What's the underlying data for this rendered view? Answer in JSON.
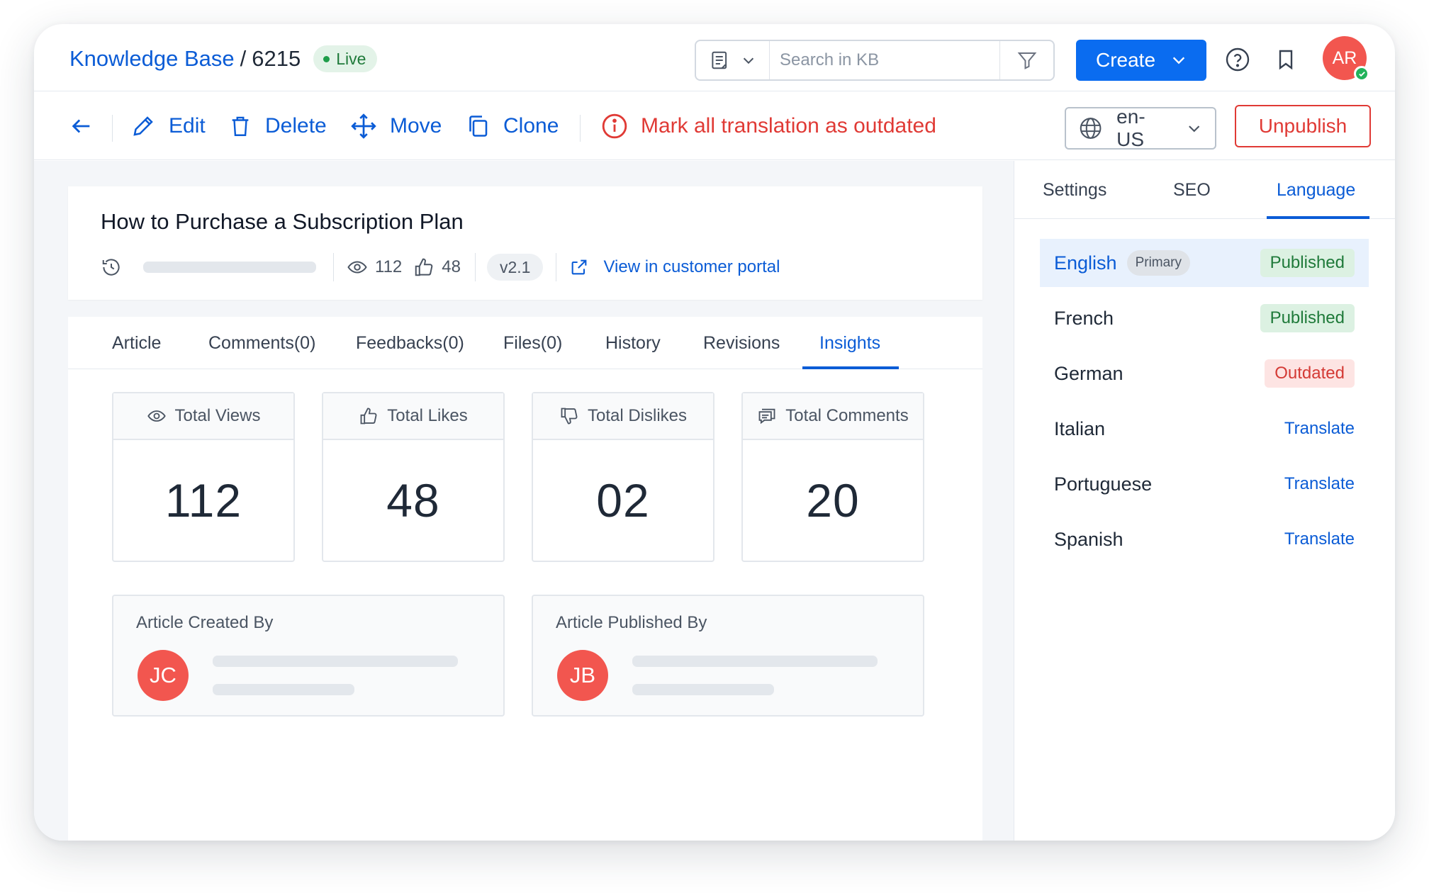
{
  "header": {
    "breadcrumb_root": "Knowledge Base",
    "breadcrumb_sep": "/",
    "breadcrumb_id": "6215",
    "status_badge": "Live",
    "search_placeholder": "Search in KB",
    "create_label": "Create",
    "user_initials": "AR"
  },
  "toolbar": {
    "edit_label": "Edit",
    "delete_label": "Delete",
    "move_label": "Move",
    "clone_label": "Clone",
    "mark_outdated_label": "Mark all translation as outdated",
    "locale_value": "en-US",
    "unpublish_label": "Unpublish"
  },
  "article": {
    "title": "How to Purchase a Subscription Plan",
    "views": "112",
    "likes": "48",
    "version": "v2.1",
    "portal_link": "View in customer portal"
  },
  "tabs": [
    {
      "label": "Article"
    },
    {
      "label": "Comments(0)"
    },
    {
      "label": "Feedbacks(0)"
    },
    {
      "label": "Files(0)"
    },
    {
      "label": "History"
    },
    {
      "label": "Revisions"
    },
    {
      "label": "Insights",
      "active": true
    }
  ],
  "stats": [
    {
      "label": "Total Views",
      "value": "112",
      "icon": "eye-icon"
    },
    {
      "label": "Total Likes",
      "value": "48",
      "icon": "thumbs-up-icon"
    },
    {
      "label": "Total Dislikes",
      "value": "02",
      "icon": "thumbs-down-icon"
    },
    {
      "label": "Total Comments",
      "value": "20",
      "icon": "comments-icon"
    }
  ],
  "people": [
    {
      "label": "Article Created By",
      "initials": "JC"
    },
    {
      "label": "Article Published By",
      "initials": "JB"
    }
  ],
  "side_tabs": [
    {
      "label": "Settings"
    },
    {
      "label": "SEO"
    },
    {
      "label": "Language",
      "active": true
    }
  ],
  "languages": [
    {
      "name": "English",
      "badge": "Primary",
      "status": "Published",
      "kind": "published",
      "selected": true
    },
    {
      "name": "French",
      "status": "Published",
      "kind": "published"
    },
    {
      "name": "German",
      "status": "Outdated",
      "kind": "outdated"
    },
    {
      "name": "Italian",
      "status": "Translate",
      "kind": "translate"
    },
    {
      "name": "Portuguese",
      "status": "Translate",
      "kind": "translate"
    },
    {
      "name": "Spanish",
      "status": "Translate",
      "kind": "translate"
    }
  ],
  "colors": {
    "primary": "#0a6cf0",
    "link": "#0b5cd6",
    "danger": "#e03a35",
    "success_bg": "#dcf1e2",
    "avatar": "#f2564f"
  }
}
